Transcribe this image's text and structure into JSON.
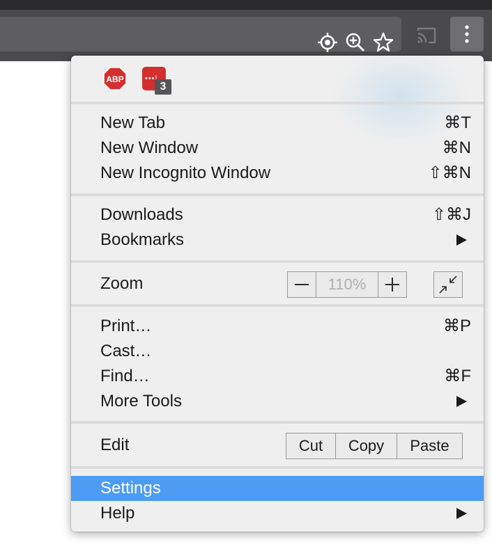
{
  "extensions": {
    "abp_text": "ABP",
    "lastpass_dots": "•••|",
    "lastpass_badge": "3"
  },
  "menu": {
    "new_tab": {
      "label": "New Tab",
      "shortcut": "⌘T"
    },
    "new_window": {
      "label": "New Window",
      "shortcut": "⌘N"
    },
    "new_incognito": {
      "label": "New Incognito Window",
      "shortcut": "⇧⌘N"
    },
    "downloads": {
      "label": "Downloads",
      "shortcut": "⇧⌘J"
    },
    "bookmarks": {
      "label": "Bookmarks"
    },
    "zoom": {
      "label": "Zoom",
      "minus": "−",
      "value": "110%",
      "plus": "+"
    },
    "print": {
      "label": "Print…",
      "shortcut": "⌘P"
    },
    "cast": {
      "label": "Cast…"
    },
    "find": {
      "label": "Find…",
      "shortcut": "⌘F"
    },
    "more_tools": {
      "label": "More Tools"
    },
    "edit": {
      "label": "Edit",
      "cut": "Cut",
      "copy": "Copy",
      "paste": "Paste"
    },
    "settings": {
      "label": "Settings"
    },
    "help": {
      "label": "Help"
    }
  },
  "icons": {
    "toolbar": [
      "location-icon",
      "zoom-in-icon",
      "bookmark-star-icon",
      "cast-icon",
      "more-vert-icon"
    ]
  },
  "colors": {
    "highlight": "#4c9cf4",
    "menu_bg": "#efefef",
    "toolbar_bg": "#4a4a4c",
    "abp_red": "#d32f2f"
  }
}
